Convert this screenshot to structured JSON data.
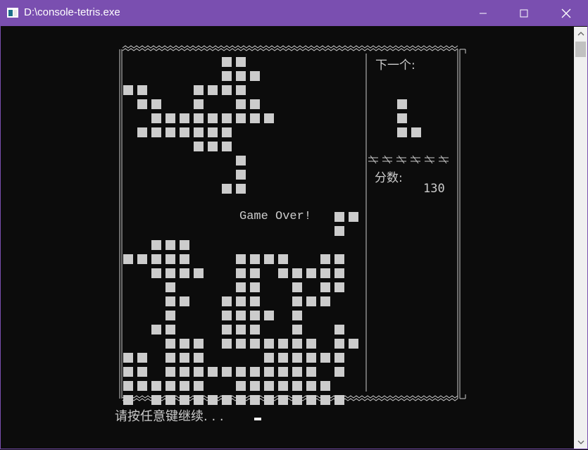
{
  "window": {
    "title": "D:\\console-tetris.exe",
    "title_bar_color": "#7a4fb0",
    "controls": {
      "minimize": "minimize-icon",
      "maximize": "maximize-icon",
      "close": "close-icon"
    }
  },
  "console": {
    "background": "#0c0c0c",
    "text_color": "#cccccc"
  },
  "game": {
    "next_label": "下一个:",
    "score_label": "分数:",
    "score_value": "130",
    "game_over_text": "Game Over!",
    "block_color": "#cccccc",
    "board_rows": [
      ".......##.",
      ".......###",
      "##...####.",
      ".##..#..##",
      "..#########",
      ".#######..",
      ".....###.",
      "........#",
      "........#",
      ".......##",
      "",
      "...............##",
      "...............#",
      "..###",
      "#####...####..##",
      "..####..##.#####",
      "...#....##..#.##",
      "...##..###..###",
      "...#...####.#",
      "..##...###..#..#",
      "...###.#######.##",
      "##.###....######",
      "##.###########.#",
      "######..#######",
      "#.##############"
    ],
    "next_piece_rows": [
      "#",
      "#",
      "##"
    ]
  },
  "prompt": {
    "text": "请按任意键继续. . ."
  }
}
